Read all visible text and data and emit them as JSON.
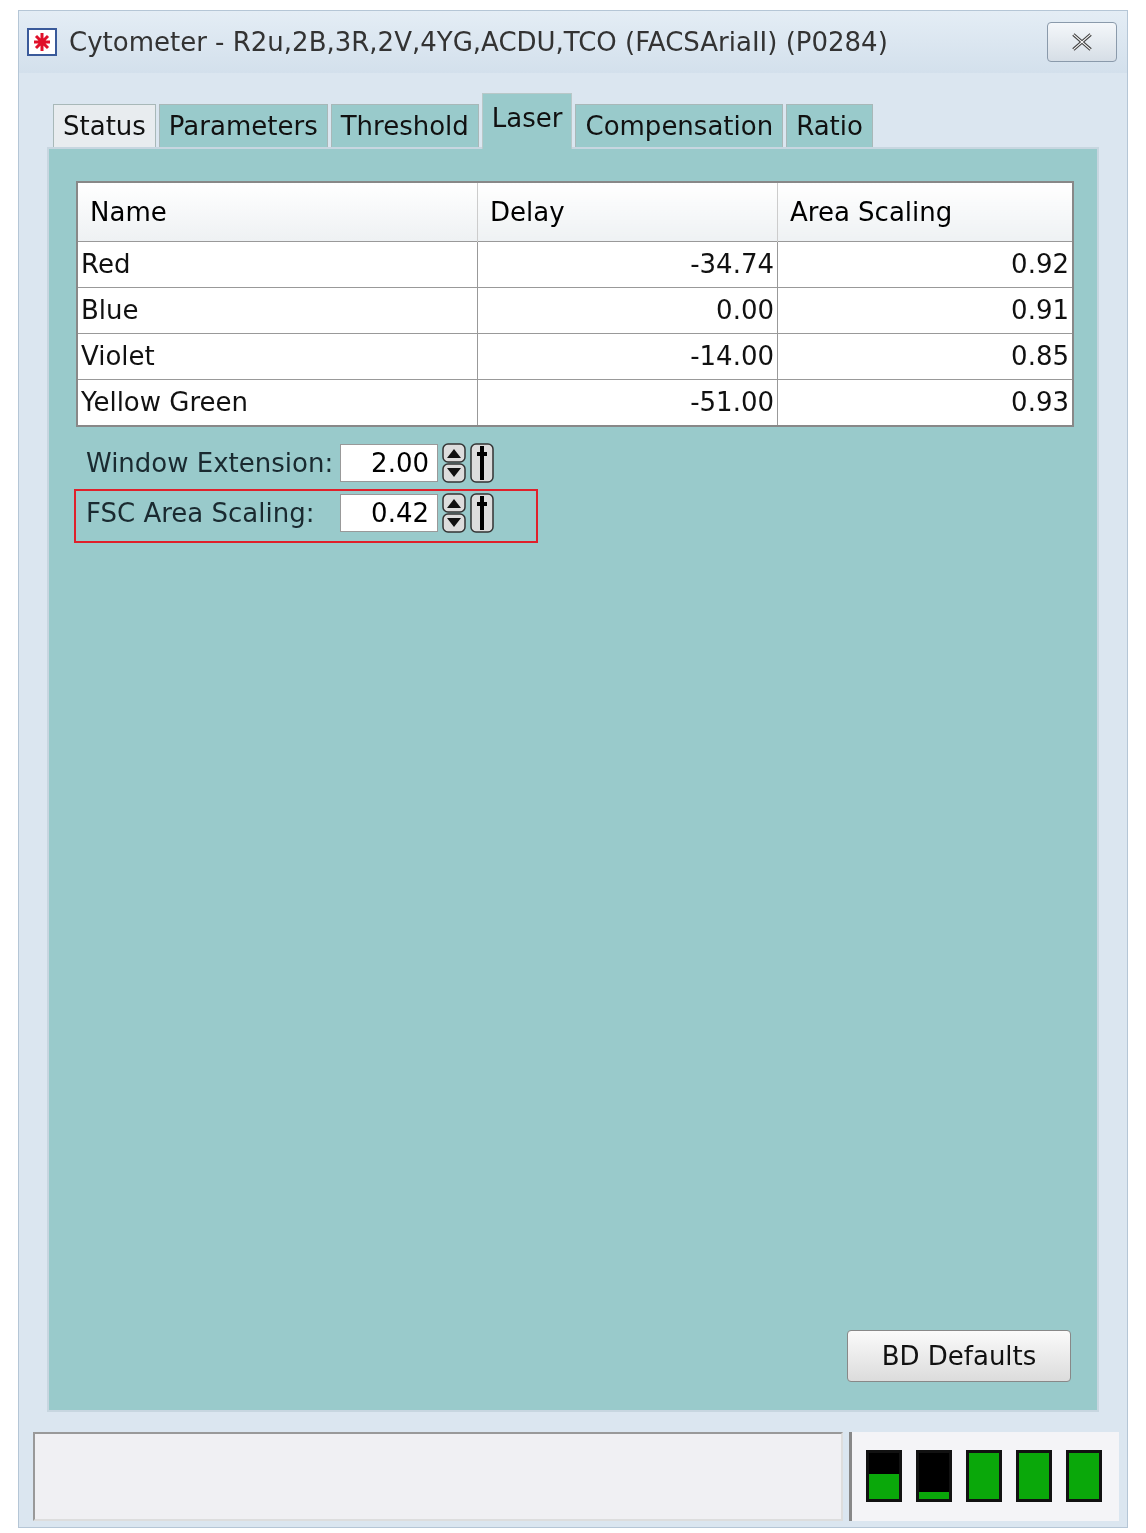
{
  "window": {
    "title": "Cytometer - R2u,2B,3R,2V,4YG,ACDU,TCO (FACSAriaII) (P0284)"
  },
  "tabs": [
    {
      "label": "Status",
      "selected": false
    },
    {
      "label": "Parameters",
      "selected": false
    },
    {
      "label": "Threshold",
      "selected": false
    },
    {
      "label": "Laser",
      "selected": true
    },
    {
      "label": "Compensation",
      "selected": false
    },
    {
      "label": "Ratio",
      "selected": false
    }
  ],
  "table": {
    "columns": [
      "Name",
      "Delay",
      "Area Scaling"
    ],
    "rows": [
      [
        "Red",
        "-34.74",
        "0.92"
      ],
      [
        "Blue",
        "0.00",
        "0.91"
      ],
      [
        "Violet",
        "-14.00",
        "0.85"
      ],
      [
        "Yellow Green",
        "-51.00",
        "0.93"
      ]
    ]
  },
  "fields": [
    {
      "label": "Window Extension:",
      "value": "2.00",
      "highlighted": false
    },
    {
      "label": "FSC Area Scaling:",
      "value": "0.42",
      "highlighted": true
    }
  ],
  "buttons": [
    "BD Defaults"
  ],
  "status_bar": {
    "meters": [
      {
        "level": 0.55
      },
      {
        "level": 0.15
      },
      {
        "level": 1
      },
      {
        "level": 1
      },
      {
        "level": 1
      }
    ]
  }
}
